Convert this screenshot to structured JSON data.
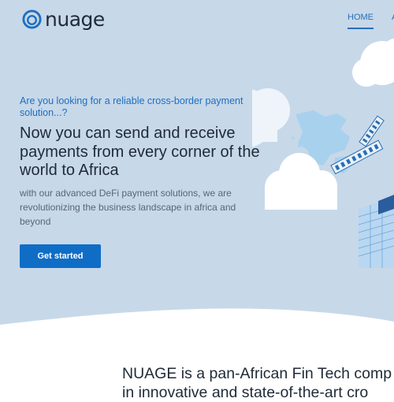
{
  "brand": {
    "name": "nuage"
  },
  "nav": {
    "items": [
      "HOME"
    ],
    "active": "HOME"
  },
  "hero": {
    "tagline": "Are you looking for a reliable cross-border payment solution...?",
    "headline": "Now you can send and receive payments from every corner of the world to Africa",
    "description": "with our advanced DeFi payment solutions, we are revolutionizing the business landscape in africa and beyond",
    "cta_label": "Get started"
  },
  "about": {
    "line1": "NUAGE is a pan-African Fin Tech comp",
    "line2": "in innovative and state-of-the-art cro"
  },
  "colors": {
    "hero_bg": "#c7d8e9",
    "accent": "#0f6dc6",
    "text": "#1f2a36"
  }
}
